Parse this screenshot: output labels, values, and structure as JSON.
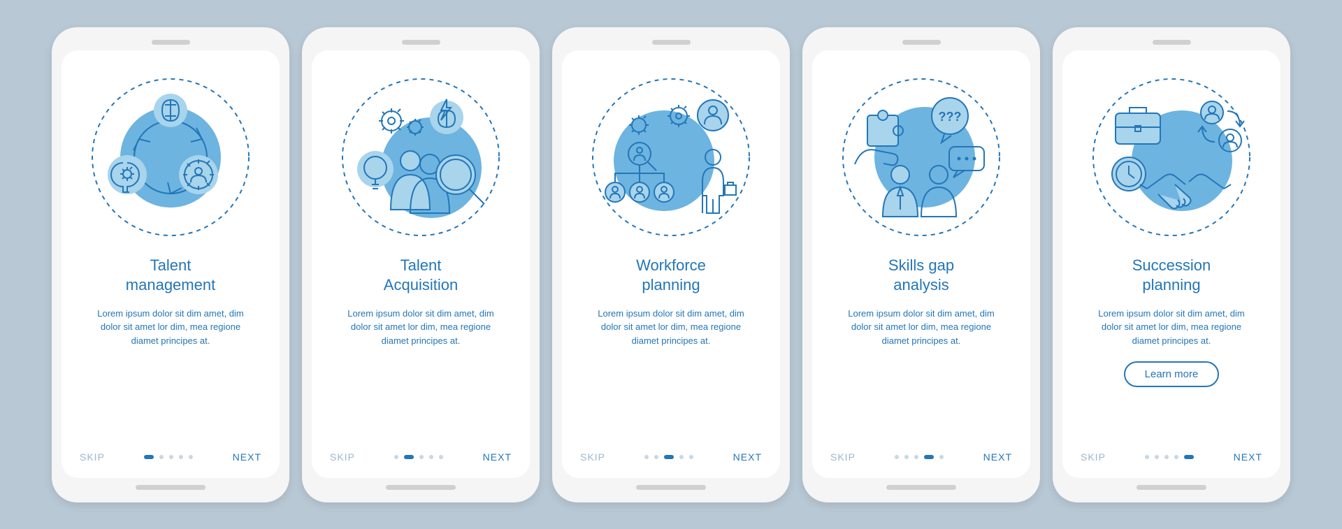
{
  "screens": [
    {
      "title": "Talent\nmanagement",
      "desc": "Lorem ipsum dolor sit dim amet, dim dolor sit amet lor dim, mea regione diamet principes at.",
      "skip": "SKIP",
      "next": "NEXT",
      "active": 0,
      "learn": null
    },
    {
      "title": "Talent\nAcquisition",
      "desc": "Lorem ipsum dolor sit dim amet, dim dolor sit amet lor dim, mea regione diamet principes at.",
      "skip": "SKIP",
      "next": "NEXT",
      "active": 1,
      "learn": null
    },
    {
      "title": "Workforce\nplanning",
      "desc": "Lorem ipsum dolor sit dim amet, dim dolor sit amet lor dim, mea regione diamet principes at.",
      "skip": "SKIP",
      "next": "NEXT",
      "active": 2,
      "learn": null
    },
    {
      "title": "Skills gap\nanalysis",
      "desc": "Lorem ipsum dolor sit dim amet, dim dolor sit amet lor dim, mea regione diamet principes at.",
      "skip": "SKIP",
      "next": "NEXT",
      "active": 3,
      "learn": null
    },
    {
      "title": "Succession\nplanning",
      "desc": "Lorem ipsum dolor sit dim amet, dim dolor sit amet lor dim, mea regione diamet principes at.",
      "skip": "SKIP",
      "next": "NEXT",
      "active": 4,
      "learn": "Learn more"
    }
  ]
}
